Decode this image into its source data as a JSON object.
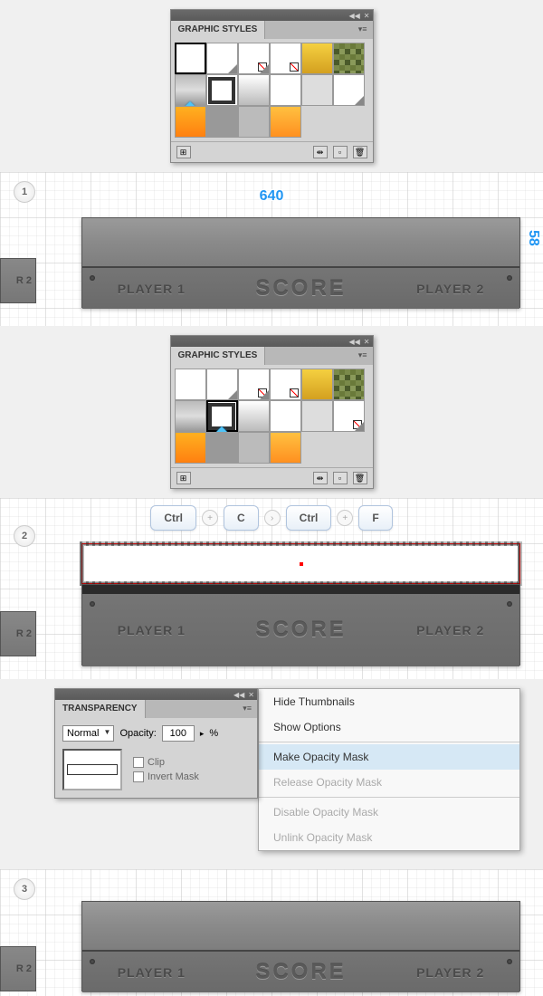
{
  "panels": {
    "graphic_styles_title": "GRAPHIC STYLES",
    "transparency_title": "TRANSPARENCY"
  },
  "artboard": {
    "width_label": "640",
    "height_label": "58",
    "player1": "PLAYER 1",
    "player2": "PLAYER 2",
    "score": "SCORE",
    "side_r2": "R 2"
  },
  "keys": {
    "ctrl": "Ctrl",
    "c": "C",
    "f": "F",
    "plus": "+",
    "then": "›"
  },
  "transparency": {
    "mode": "Normal",
    "opacity_label": "Opacity:",
    "opacity_value": "100",
    "percent": "%",
    "clip": "Clip",
    "invert": "Invert Mask"
  },
  "menu": {
    "hide_thumbs": "Hide Thumbnails",
    "show_options": "Show Options",
    "make_mask": "Make Opacity Mask",
    "release_mask": "Release Opacity Mask",
    "disable_mask": "Disable Opacity Mask",
    "unlink_mask": "Unlink Opacity Mask"
  },
  "steps": {
    "s1": "1",
    "s2": "2",
    "s3": "3"
  }
}
